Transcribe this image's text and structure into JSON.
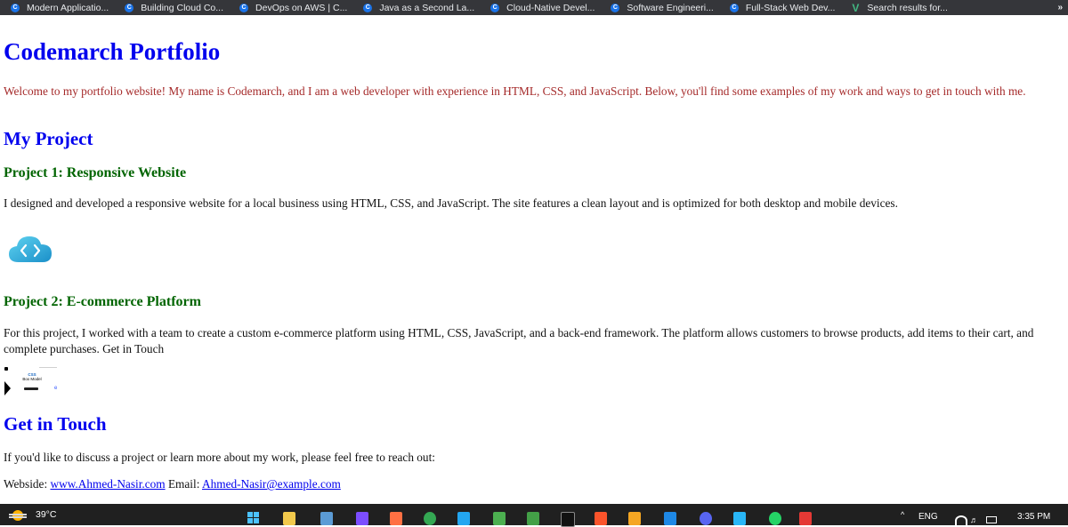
{
  "bookmarks": {
    "items": [
      {
        "icon": "C",
        "label": "Modern Applicatio..."
      },
      {
        "icon": "C",
        "label": "Building Cloud Co..."
      },
      {
        "icon": "C",
        "label": "DevOps on AWS | C..."
      },
      {
        "icon": "C",
        "label": "Java as a Second La..."
      },
      {
        "icon": "C",
        "label": "Cloud-Native Devel..."
      },
      {
        "icon": "C",
        "label": "Software Engineeri..."
      },
      {
        "icon": "C",
        "label": "Full-Stack Web Dev..."
      },
      {
        "icon": "V",
        "label": "Search results for..."
      }
    ],
    "more": "»"
  },
  "page": {
    "title": "Codemarch Portfolio",
    "intro": "Welcome to my portfolio website! My name is Codemarch, and I am a web developer with experience in HTML, CSS, and JavaScript. Below, you'll find some examples of my work and ways to get in touch with me.",
    "projects_heading": "My Project",
    "project1": {
      "title": "Project 1: Responsive Website",
      "description": "I designed and developed a responsive website for a local business using HTML, CSS, and JavaScript. The site features a clean layout and is optimized for both desktop and mobile devices."
    },
    "project2": {
      "title": "Project 2: E-commerce Platform",
      "description": "For this project, I worked with a team to create a custom e-commerce platform using HTML, CSS, JavaScript, and a back-end framework. The platform allows customers to browse products, add items to their cart, and complete purchases. Get in Touch"
    },
    "thumbnail": {
      "line1": "CSS",
      "line2": "Box Model",
      "mark": "e"
    },
    "contact": {
      "heading": "Get in Touch",
      "text": "If you'd like to discuss a project or learn more about my work, please feel free to reach out:",
      "website_label": "Webside:",
      "website": "www.Ahmed-Nasir.com",
      "email_label": "Email:",
      "email": "Ahmed-Nasir@example.com"
    }
  },
  "taskbar": {
    "temperature": "39°C",
    "language": "ENG",
    "time": "3:35 PM",
    "tray_caret": "^"
  },
  "colors": {
    "heading_blue": "#0000ee",
    "intro_brown": "#a52a2a",
    "project_green": "#006400",
    "taskbar_bg": "#202020",
    "bookmarks_bg": "#35363a"
  }
}
